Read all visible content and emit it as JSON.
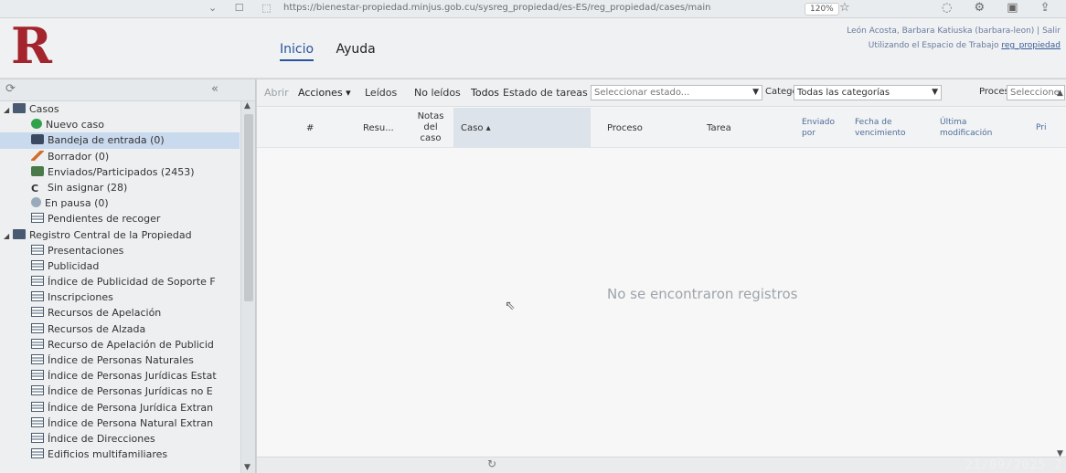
{
  "browser": {
    "url": "https://bienestar-propiedad.minjus.gob.cu/sysreg_propiedad/es-ES/reg_propiedad/cases/main",
    "zoom": "120%"
  },
  "header": {
    "logo_letter": "R",
    "nav": [
      "Inicio",
      "Ayuda"
    ],
    "user_line": "León Acosta, Barbara Katiuska (barbara-leon) | Salir",
    "workspace_prefix": "Utilizando el Espacio de Trabajo ",
    "workspace_link": "reg_propiedad"
  },
  "sidebar": {
    "groups": [
      {
        "label": "Casos",
        "items": [
          {
            "label": "Nuevo caso",
            "icon": "new-case-icon"
          },
          {
            "label": "Bandeja de entrada (0)",
            "icon": "inbox-icon",
            "selected": true
          },
          {
            "label": "Borrador (0)",
            "icon": "draft-icon"
          },
          {
            "label": "Enviados/Participados (2453)",
            "icon": "sent-icon"
          },
          {
            "label": "Sin asignar (28)",
            "icon": "unassigned-icon"
          },
          {
            "label": "En pausa (0)",
            "icon": "pause-icon"
          },
          {
            "label": "Pendientes de recoger",
            "icon": "list-icon"
          }
        ]
      },
      {
        "label": "Registro Central de la Propiedad",
        "items": [
          {
            "label": "Presentaciones"
          },
          {
            "label": "Publicidad"
          },
          {
            "label": "Índice de Publicidad de Soporte F"
          },
          {
            "label": "Inscripciones"
          },
          {
            "label": "Recursos de Apelación"
          },
          {
            "label": "Recursos de Alzada"
          },
          {
            "label": "Recurso de Apelación de Publicid"
          },
          {
            "label": "Índice de Personas Naturales"
          },
          {
            "label": "Índice de Personas Jurídicas Estat"
          },
          {
            "label": "Índice de Personas Jurídicas no E"
          },
          {
            "label": "Índice de Persona Jurídica Extran"
          },
          {
            "label": "Índice de Persona Natural Extran"
          },
          {
            "label": "Índice de Direcciones"
          },
          {
            "label": "Edificios multifamiliares"
          }
        ]
      }
    ]
  },
  "toolbar": {
    "abrir": "Abrir",
    "acciones": "Acciones",
    "leidos": "Leídos",
    "no_leidos": "No leídos",
    "todos": "Todos",
    "estado_label": "Estado de tareas",
    "estado_placeholder": "Seleccionar estado...",
    "categoria_label": "Categoría",
    "categoria_value": "Todas las categorías",
    "proceso_label": "Proceso",
    "proceso_value": "Seleccione"
  },
  "grid": {
    "columns": [
      "#",
      "Resu...",
      "Notas del caso",
      "Caso",
      "Proceso",
      "Tarea",
      "Enviado por",
      "Fecha de vencimiento",
      "Última modificación",
      "Pri"
    ],
    "empty_message": "No se encontraron registros"
  },
  "photo_timestamp": "21/09/2025  2"
}
